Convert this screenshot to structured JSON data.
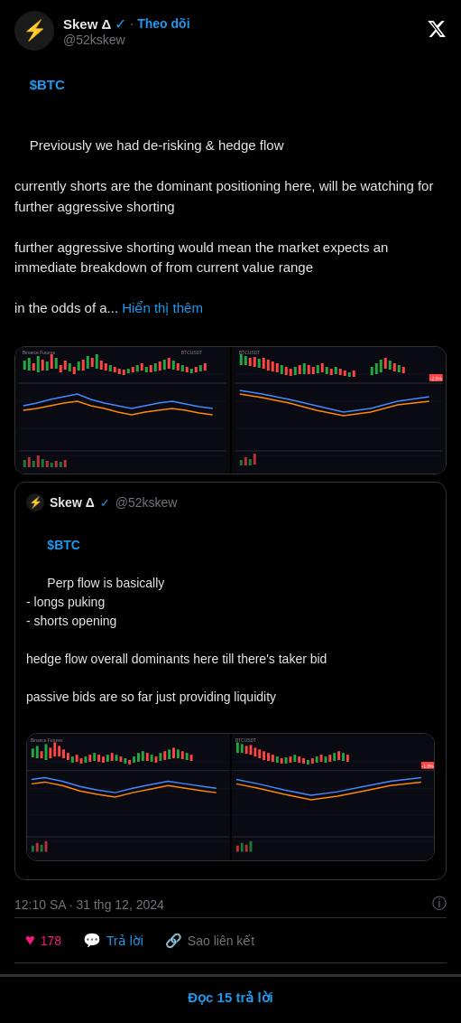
{
  "main_tweet": {
    "user": {
      "name": "Skew Δ",
      "handle": "@52kskew",
      "verified": true
    },
    "follow_label": "Theo dõi",
    "content_line1": "$BTC",
    "content_body": "Previously we had de-risking & hedge flow\n\ncurrently shorts are the dominant positioning here, will be watching for further aggressive shorting\n\nfurther aggressive shorting would mean the market expects an immediate breakdown of from current value range\n\nin the odds of a...",
    "show_more": "Hiển thị thêm",
    "timestamp": "12:10 SA · 31 thg 12, 2024"
  },
  "quoted_tweet": {
    "user": {
      "name": "Skew Δ",
      "handle": "@52kskew",
      "verified": true
    },
    "content": "$BTC\nPerp flow is basically\n- longs puking\n- shorts opening\n\nhedge flow overall dominants here till there's taker bid\n\npassive bids are so far just providing liquidity"
  },
  "actions": {
    "heart_count": "178",
    "heart_label": "178",
    "reply_label": "Trả lời",
    "share_label": "Sao liên kết"
  },
  "view_replies": "Đọc 15 trả lời",
  "icons": {
    "heart": "♥",
    "reply": "💬",
    "link": "🔗",
    "info": "ⓘ",
    "x_logo": "✕"
  }
}
